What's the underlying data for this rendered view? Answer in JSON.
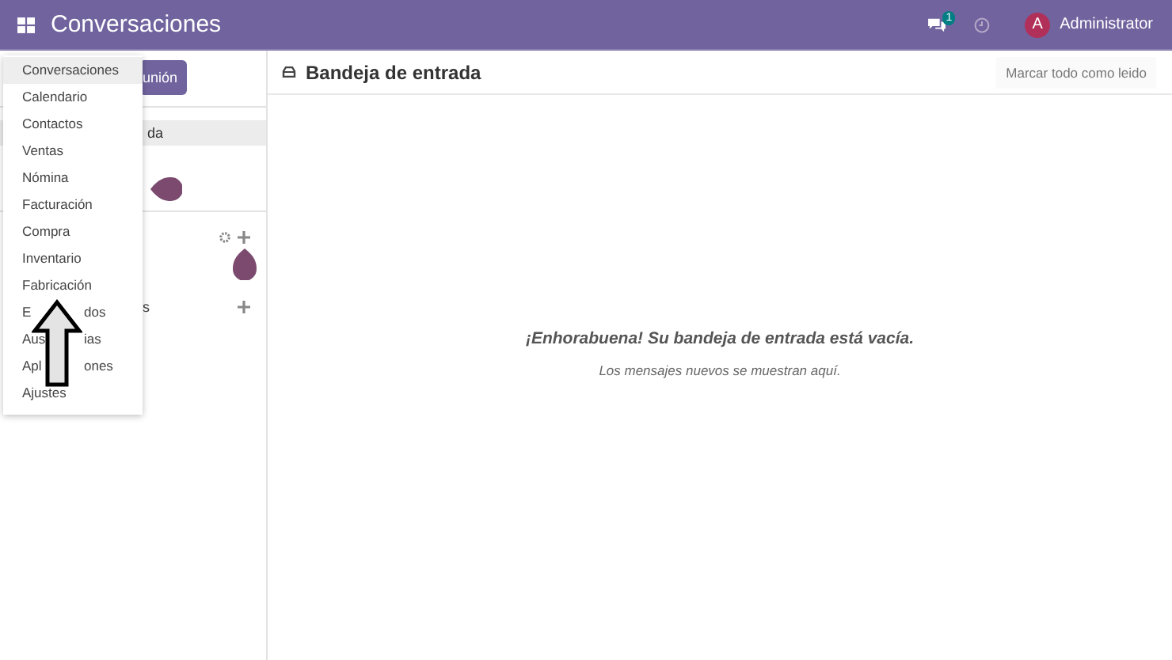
{
  "topbar": {
    "app_title": "Conversaciones",
    "chat_badge": "1",
    "avatar_letter": "A",
    "user": "Administrator"
  },
  "app_menu": [
    {
      "label": "Conversaciones",
      "selected": true
    },
    {
      "label": "Calendario",
      "selected": false
    },
    {
      "label": "Contactos",
      "selected": false
    },
    {
      "label": "Ventas",
      "selected": false
    },
    {
      "label": "Nómina",
      "selected": false
    },
    {
      "label": "Facturación",
      "selected": false
    },
    {
      "label": "Compra",
      "selected": false
    },
    {
      "label": "Inventario",
      "selected": false
    },
    {
      "label": "Fabricación",
      "selected": false
    },
    {
      "label_parts": [
        "E",
        "dos"
      ],
      "selected": false
    },
    {
      "label_parts": [
        "Aus",
        "ias"
      ],
      "selected": false
    },
    {
      "label_parts": [
        "Apl",
        "ones"
      ],
      "selected": false
    },
    {
      "label": "Ajustes",
      "selected": false
    }
  ],
  "sidebar": {
    "button": "unión",
    "inbox_item": "da",
    "section_label": "s"
  },
  "main": {
    "title": "Bandeja de entrada",
    "mark_all_button": "Marcar todo como leido",
    "empty_title": "¡Enhorabuena! Su bandeja de entrada está vacía.",
    "empty_hint": "Los mensajes nuevos se muestran aquí."
  }
}
